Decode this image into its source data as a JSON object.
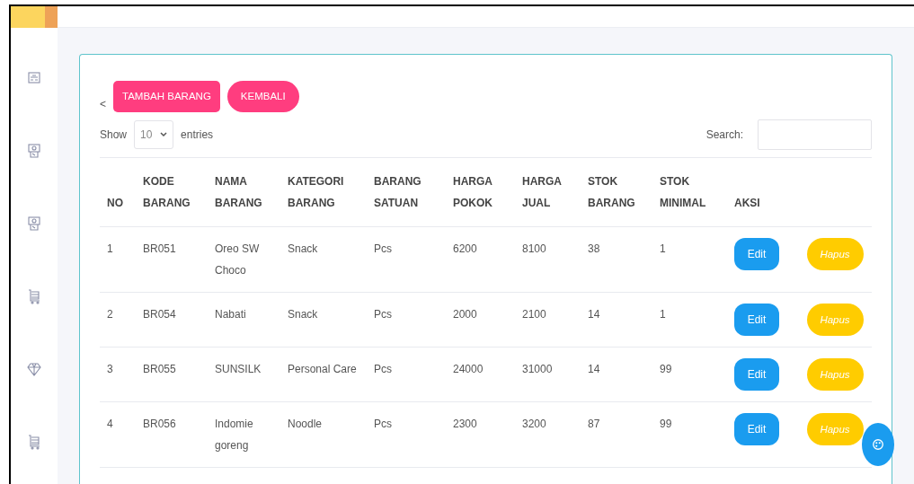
{
  "sidebar": {
    "items": [
      {
        "kind": "card"
      },
      {
        "kind": "money"
      },
      {
        "kind": "money"
      },
      {
        "kind": "cart"
      },
      {
        "kind": "diamond"
      },
      {
        "kind": "cart"
      }
    ]
  },
  "toolbar": {
    "back": "<",
    "buttons": [
      {
        "label": "TAMBAH BARANG",
        "kind": "square"
      },
      {
        "label": "KEMBALI",
        "kind": "pill"
      }
    ]
  },
  "length": {
    "before": "Show",
    "value": "10",
    "after": "entries"
  },
  "search": {
    "label": "Search:"
  },
  "table": {
    "columns": [
      "NO",
      "KODE BARANG",
      "NAMA BARANG",
      "KATEGORI BARANG",
      "BARANG SATUAN",
      "HARGA POKOK",
      "HARGA JUAL",
      "STOK BARANG",
      "STOK MINIMAL",
      "AKSI"
    ],
    "rows": [
      {
        "cells": [
          "1",
          "BR051",
          "Oreo SW Choco",
          "Snack",
          "Pcs",
          "6200",
          "8100",
          "38",
          "1"
        ],
        "edit": "Edit",
        "delete": "Hapus"
      },
      {
        "cells": [
          "2",
          "BR054",
          "Nabati",
          "Snack",
          "Pcs",
          "2000",
          "2100",
          "14",
          "1"
        ],
        "edit": "Edit",
        "delete": "Hapus"
      },
      {
        "cells": [
          "3",
          "BR055",
          "SUNSILK",
          "Personal Care",
          "Pcs",
          "24000",
          "31000",
          "14",
          "99"
        ],
        "edit": "Edit",
        "delete": "Hapus"
      },
      {
        "cells": [
          "4",
          "BR056",
          "Indomie goreng",
          "Noodle",
          "Pcs",
          "2300",
          "3200",
          "87",
          "99"
        ],
        "edit": "Edit",
        "delete": "Hapus"
      }
    ]
  },
  "fab": {
    "kind": "palette"
  }
}
